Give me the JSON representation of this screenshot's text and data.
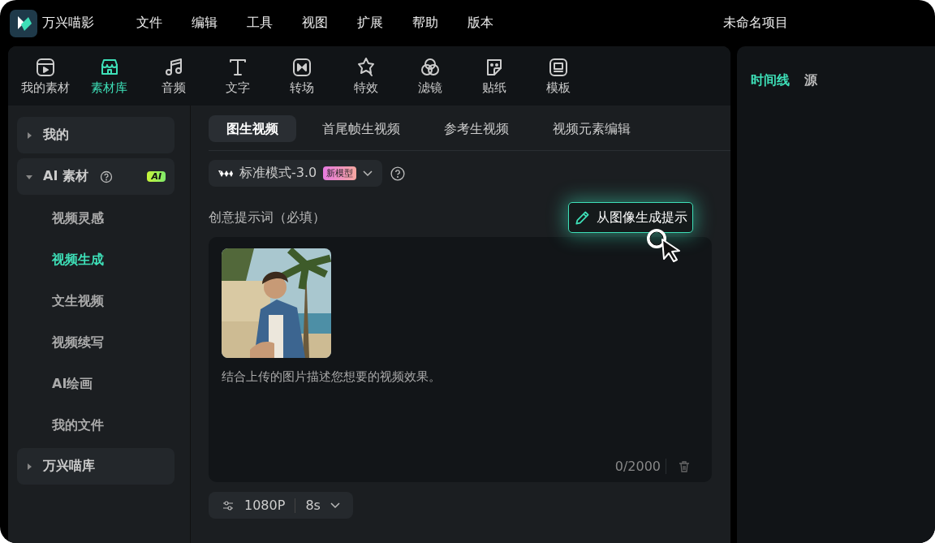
{
  "app": {
    "name": "万兴喵影"
  },
  "menu": [
    "文件",
    "编辑",
    "工具",
    "视图",
    "扩展",
    "帮助",
    "版本"
  ],
  "project_title": "未命名项目",
  "toolbar": [
    {
      "label": "我的素材",
      "kind": "media",
      "selected": false
    },
    {
      "label": "素材库",
      "kind": "store",
      "selected": true
    },
    {
      "label": "音频",
      "kind": "audio",
      "selected": false
    },
    {
      "label": "文字",
      "kind": "text",
      "selected": false
    },
    {
      "label": "转场",
      "kind": "transition",
      "selected": false
    },
    {
      "label": "特效",
      "kind": "effect",
      "selected": false
    },
    {
      "label": "滤镜",
      "kind": "filter",
      "selected": false
    },
    {
      "label": "贴纸",
      "kind": "sticker",
      "selected": false
    },
    {
      "label": "模板",
      "kind": "template",
      "selected": false
    }
  ],
  "sidebar": [
    {
      "kind": "group",
      "label": "我的",
      "expanded": false
    },
    {
      "kind": "group",
      "label": "AI 素材",
      "expanded": true,
      "help": true,
      "badge": "AI"
    },
    {
      "kind": "item",
      "label": "视频灵感",
      "selected": false
    },
    {
      "kind": "item",
      "label": "视频生成",
      "selected": true
    },
    {
      "kind": "item",
      "label": "文生视频",
      "selected": false
    },
    {
      "kind": "item",
      "label": "视频续写",
      "selected": false
    },
    {
      "kind": "item",
      "label": "AI绘画",
      "selected": false
    },
    {
      "kind": "item",
      "label": "我的文件",
      "selected": false
    },
    {
      "kind": "group",
      "label": "万兴喵库",
      "expanded": false
    }
  ],
  "tabs": [
    {
      "label": "图生视频",
      "selected": true
    },
    {
      "label": "首尾帧生视频",
      "selected": false
    },
    {
      "label": "参考生视频",
      "selected": false
    },
    {
      "label": "视频元素编辑",
      "selected": false
    }
  ],
  "model": {
    "label": "标准模式-3.0",
    "badge": "新模型"
  },
  "prompt": {
    "label": "创意提示词（必填）",
    "generate_button": "从图像生成提示",
    "placeholder": "结合上传的图片描述您想要的视频效果。",
    "counter": "0/2000"
  },
  "settings": {
    "resolution": "1080P",
    "duration": "8s"
  },
  "right_tabs": [
    {
      "label": "时间线",
      "selected": true
    },
    {
      "label": "源",
      "selected": false
    }
  ]
}
